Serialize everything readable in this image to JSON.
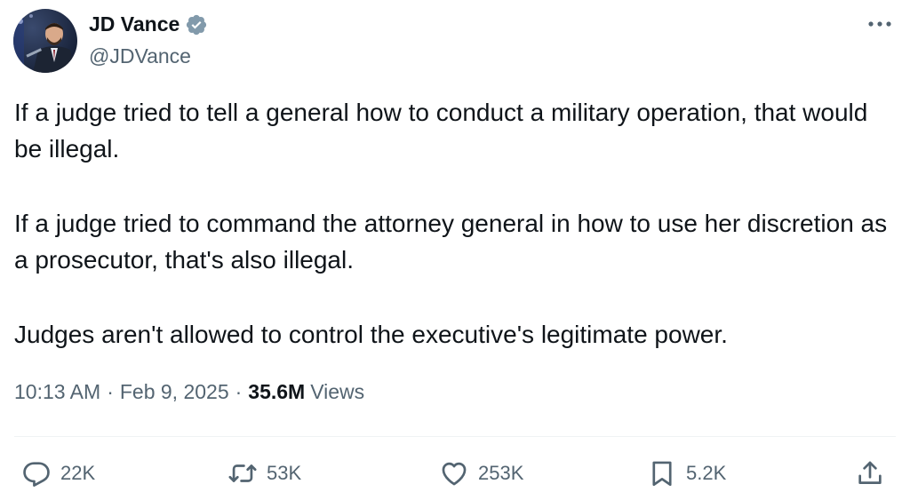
{
  "author": {
    "name": "JD Vance",
    "handle": "@JDVance",
    "verified_color": "#829aab"
  },
  "tweet": {
    "paragraphs": [
      "If a judge tried to tell a general how to conduct a military operation, that would be illegal.",
      "If a judge tried to command the attorney general in how to use her discretion as a prosecutor, that's also illegal.",
      "Judges aren't allowed to control the executive's legitimate power."
    ]
  },
  "meta": {
    "time": "10:13 AM",
    "separator": "·",
    "date": "Feb 9, 2025",
    "views_count": "35.6M",
    "views_label": "Views"
  },
  "actions": {
    "replies": "22K",
    "reposts": "53K",
    "likes": "253K",
    "bookmarks": "5.2K"
  },
  "icons": {
    "more": "more-horizontal-icon",
    "reply": "reply-icon",
    "repost": "repost-icon",
    "like": "heart-icon",
    "bookmark": "bookmark-icon",
    "share": "share-icon"
  }
}
